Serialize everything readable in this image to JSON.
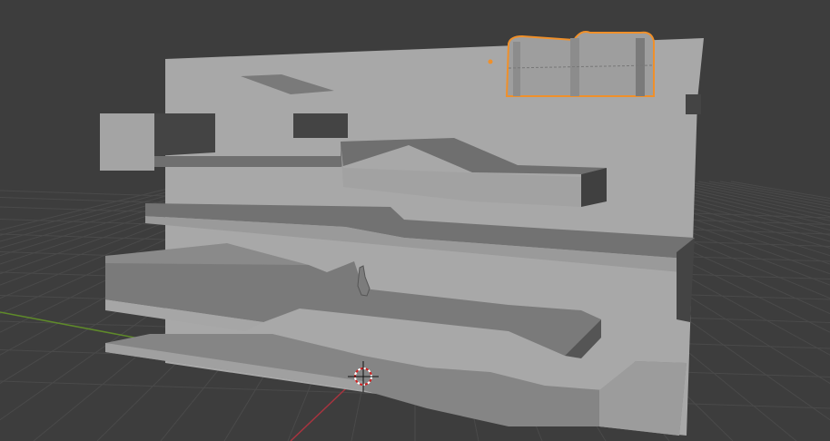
{
  "viewport": {
    "type": "3d-viewport",
    "colors": {
      "background": "#3d3d3d",
      "grid": "#4a4a4a",
      "x_axis": "#a8343f",
      "y_axis": "#5f8a2a",
      "selection_outline": "#f0902a",
      "surface_light": "#a9a9a9",
      "surface_mid": "#7d7d7d",
      "surface_dark": "#424242"
    },
    "objects": [
      {
        "name": "level-wall",
        "selected": false
      },
      {
        "name": "treasure-chest",
        "selected": true
      },
      {
        "name": "character-figure",
        "selected": false
      }
    ],
    "icons": [
      "3d-cursor-icon",
      "object-origin-icon"
    ]
  }
}
